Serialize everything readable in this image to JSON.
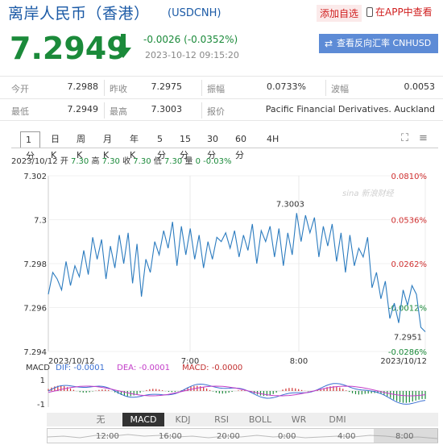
{
  "header": {
    "title": "离岸人民币（香港）",
    "code": "(USDCNH)",
    "add_favorite": "添加自选",
    "app_link": "在APP中查看"
  },
  "quote": {
    "price": "7.2949",
    "change": "-0.0026 (-0.0352%)",
    "timestamp": "2023-10-12 09:15:20",
    "reverse_button": "查看反向汇率 CNHUSD"
  },
  "stats": {
    "open_label": "今开",
    "open_value": "7.2988",
    "prev_close_label": "昨收",
    "prev_close_value": "7.2975",
    "amplitude_label": "振幅",
    "amplitude_value": "0.0733%",
    "swing_label": "波幅",
    "swing_value": "0.0053",
    "low_label": "最低",
    "low_value": "7.2949",
    "high_label": "最高",
    "high_value": "7.3003",
    "quote_label": "报价",
    "quote_value": "Pacific Financial Derivatives. Auckland"
  },
  "tabs": [
    "1分",
    "日K",
    "周K",
    "月K",
    "年K",
    "5分",
    "15分",
    "30分",
    "60分",
    "4H"
  ],
  "active_tab": "1分",
  "ohlc": {
    "date": "2023/10/12",
    "open_label": "开",
    "open": "7.30",
    "high_label": "高",
    "high": "7.30",
    "close_label": "收",
    "close": "7.30",
    "low_label": "低",
    "low": "7.30",
    "volume_label": "量",
    "volume": "0",
    "pct": "-0.03%"
  },
  "chart_data": {
    "type": "line",
    "y_ticks": [
      "7.302",
      "7.3",
      "7.298",
      "7.296",
      "7.294"
    ],
    "ylim": [
      7.294,
      7.302
    ],
    "pct_ticks": [
      {
        "label": "0.0810%",
        "value": 7.302,
        "color": "#d03030"
      },
      {
        "label": "0.0536%",
        "value": 7.3,
        "color": "#d03030"
      },
      {
        "label": "0.0262%",
        "value": 7.298,
        "color": "#d03030"
      },
      {
        "label": "-0.0012%",
        "value": 7.296,
        "color": "#1b8a3a"
      },
      {
        "label": "-0.0286%",
        "value": 7.294,
        "color": "#1b8a3a"
      }
    ],
    "x_labels": [
      "2023/10/12",
      "7:00",
      "8:00",
      "2023/10/12"
    ],
    "annotations": {
      "high": "7.3003",
      "last": "7.2951"
    },
    "watermark": "sina 新浪财经",
    "series": [
      {
        "values": [
          7.2966,
          7.2976,
          7.2973,
          7.2968,
          7.2981,
          7.297,
          7.2979,
          7.2974,
          7.2986,
          7.2975,
          7.2992,
          7.2982,
          7.2991,
          7.2973,
          7.2988,
          7.2978,
          7.2993,
          7.298,
          7.2994,
          7.2971,
          7.2989,
          7.2965,
          7.2982,
          7.2976,
          7.299,
          7.2984,
          7.2995,
          7.2987,
          7.2999,
          7.2979,
          7.2997,
          7.2984,
          7.2996,
          7.2982,
          7.2993,
          7.2978,
          7.299,
          7.2982,
          7.2992,
          7.299,
          7.2994,
          7.2987,
          7.2995,
          7.2983,
          7.2993,
          7.2986,
          7.2998,
          7.298,
          7.2995,
          7.299,
          7.2997,
          7.2983,
          7.2996,
          7.2979,
          7.2994,
          7.2984,
          7.3003,
          7.299,
          7.3002,
          7.2994,
          7.3001,
          7.2983,
          7.2997,
          7.2988,
          7.2998,
          7.2981,
          7.2994,
          7.2976,
          7.2993,
          7.2979,
          7.2987,
          7.2983,
          7.2992,
          7.2969,
          7.2976,
          7.2964,
          7.2972,
          7.2955,
          7.2962,
          7.2953,
          7.2968,
          7.2961,
          7.297,
          7.2966,
          7.2951,
          7.2949
        ]
      }
    ],
    "macd": {
      "label": "MACD",
      "dif": "DIF: -0.0001",
      "dea": "DEA: -0.0001",
      "macd": "MACD: -0.0000",
      "ticks": [
        "1",
        "-1"
      ]
    }
  },
  "indicators": [
    "无",
    "MACD",
    "KDJ",
    "RSI",
    "BOLL",
    "WR",
    "DMI"
  ],
  "active_indicator": "MACD",
  "timeline": [
    "12:00",
    "16:00",
    "20:00",
    "0:00",
    "4:00",
    "8:00"
  ],
  "colors": {
    "up": "#d03030",
    "down": "#1b8a3a",
    "line": "#2b7bbf",
    "brand": "#1b5aa6"
  }
}
